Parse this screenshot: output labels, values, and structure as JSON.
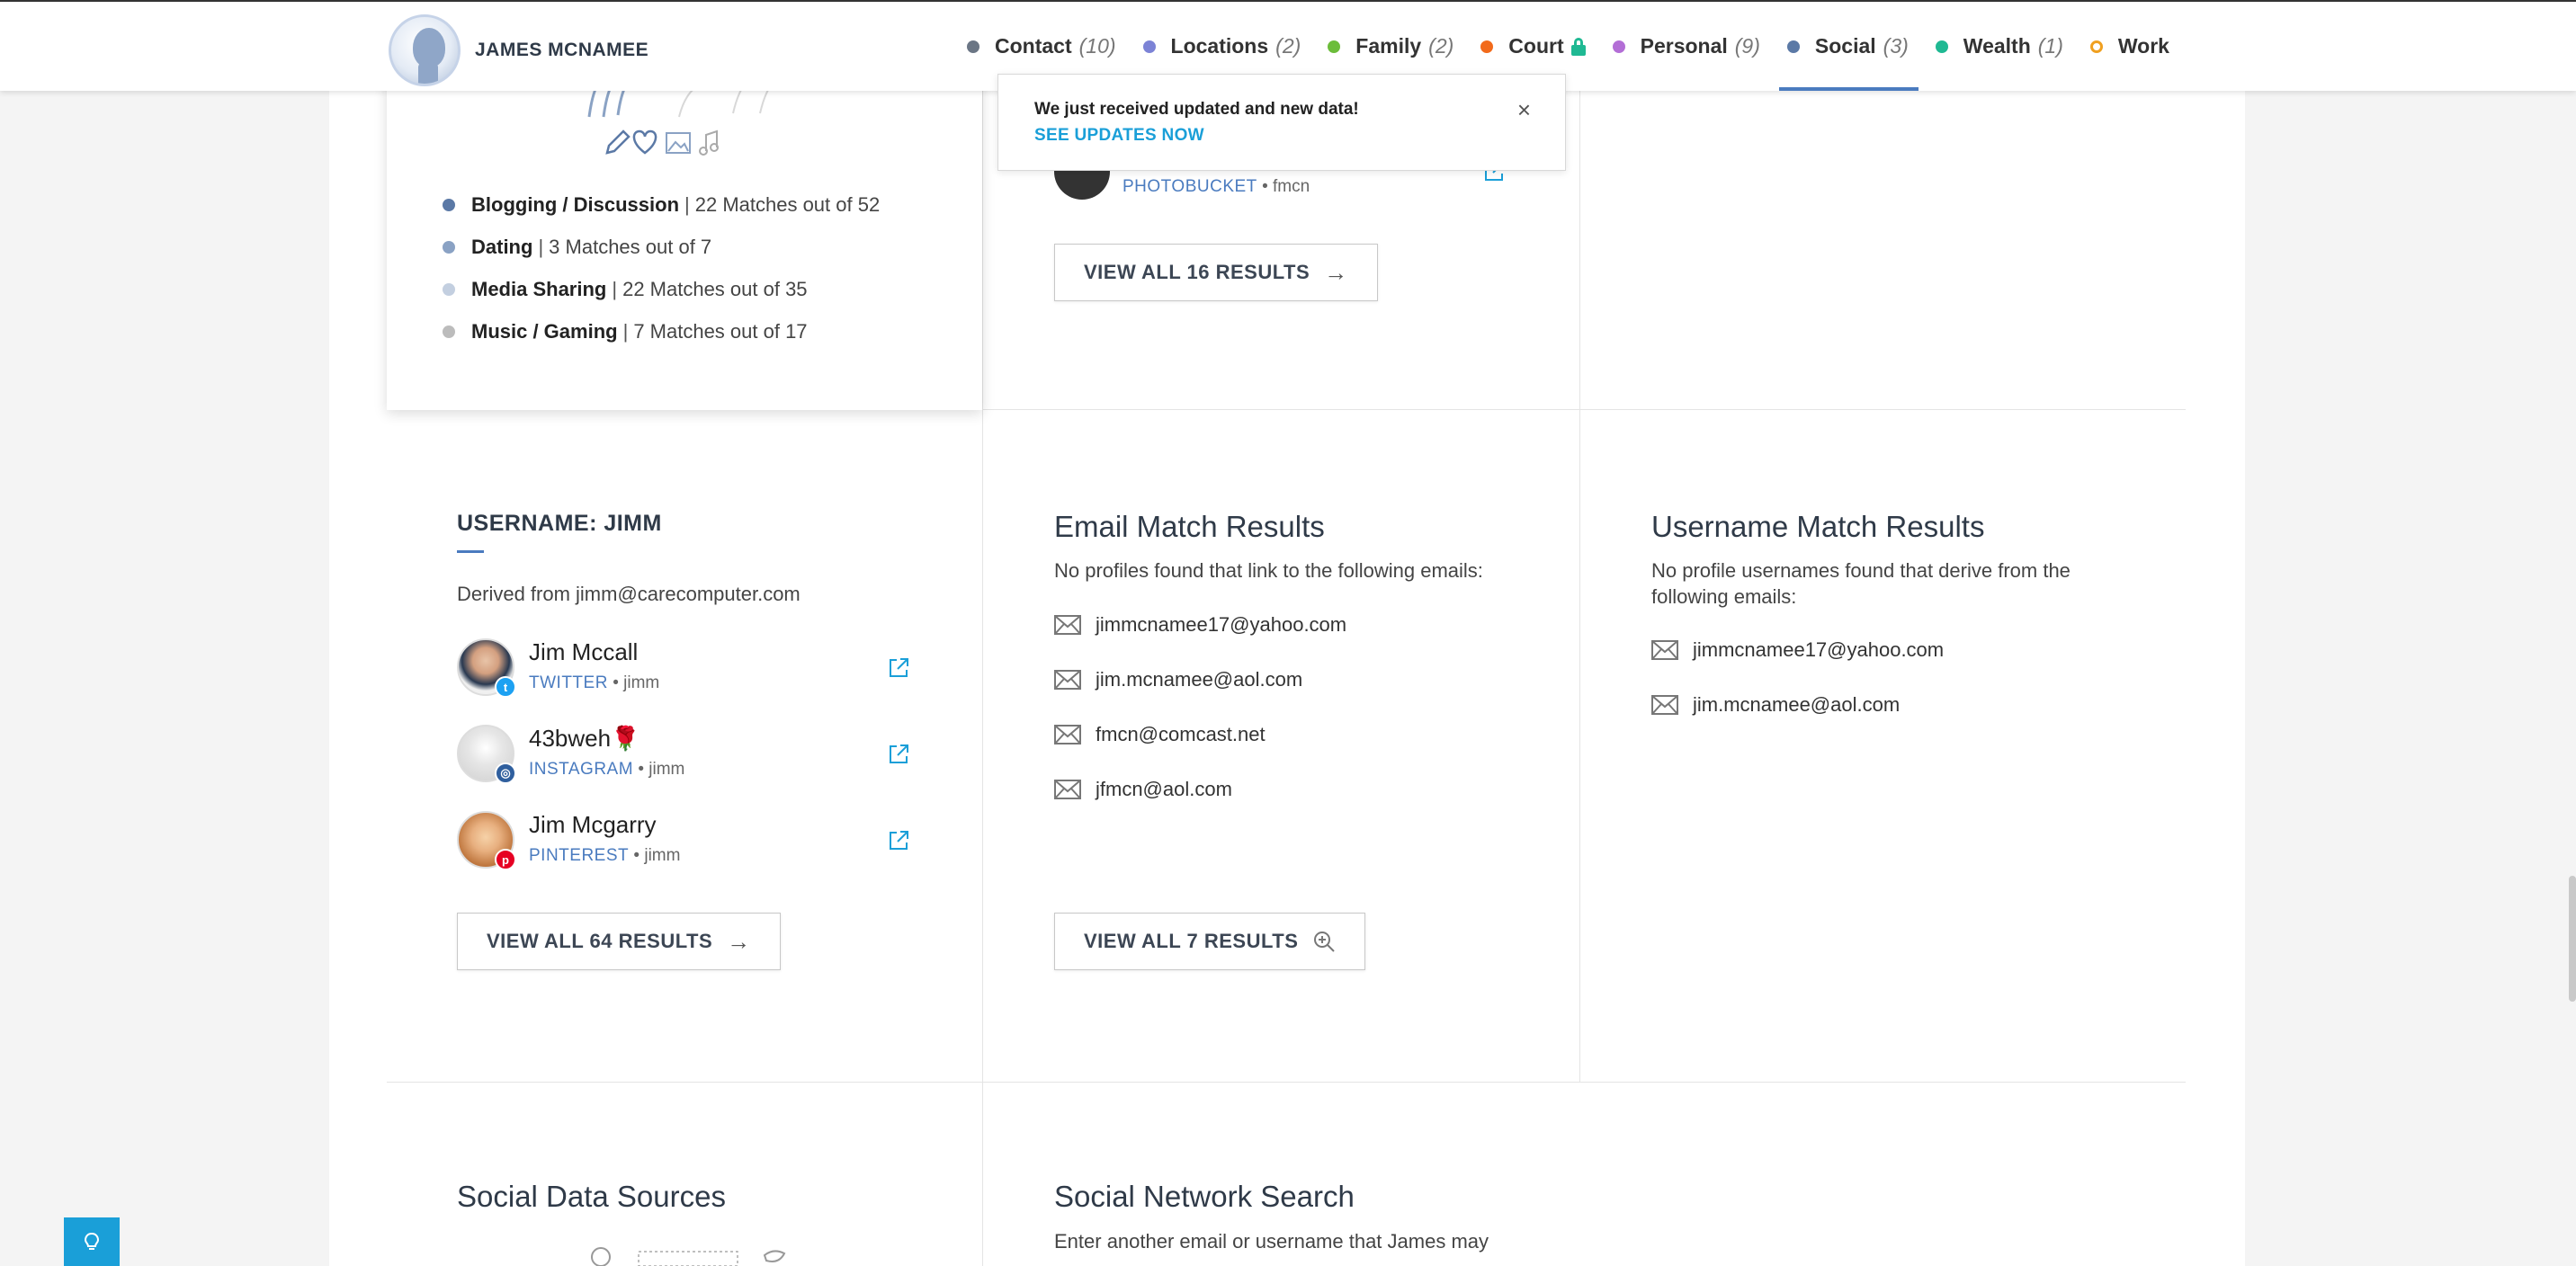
{
  "header": {
    "name": "JAMES MCNAMEE",
    "nav": [
      {
        "label": "Contact",
        "count": "(10)",
        "color": "#6b7685"
      },
      {
        "label": "Locations",
        "count": "(2)",
        "color": "#7c83d6"
      },
      {
        "label": "Family",
        "count": "(2)",
        "color": "#6cbd3a"
      },
      {
        "label": "Court",
        "count": "",
        "color": "#f26a1b",
        "locked": true
      },
      {
        "label": "Personal",
        "count": "(9)",
        "color": "#b36ed6"
      },
      {
        "label": "Social",
        "count": "(3)",
        "color": "#5b79a6",
        "active": true
      },
      {
        "label": "Wealth",
        "count": "(1)",
        "color": "#1fb993"
      },
      {
        "label": "Work",
        "count": "",
        "color": "#f0a020",
        "ring": true
      }
    ]
  },
  "toast": {
    "message": "We just received updated and new data!",
    "link": "SEE UPDATES NOW"
  },
  "categories": [
    {
      "label": "Blogging / Discussion",
      "value": "22 Matches out of 52",
      "color": "#5b79a6"
    },
    {
      "label": "Dating",
      "value": "3 Matches out of 7",
      "color": "#8aa2c4"
    },
    {
      "label": "Media Sharing",
      "value": "22 Matches out of 35",
      "color": "#c3cfe0"
    },
    {
      "label": "Music / Gaming",
      "value": "7 Matches out of 17",
      "color": "#bcbcbc"
    }
  ],
  "separator": "|",
  "top_match": {
    "network": "PHOTOBUCKET",
    "handle": "fmcn"
  },
  "buttons": {
    "view_all_16": "VIEW ALL 16 RESULTS",
    "view_all_64": "VIEW ALL 64 RESULTS",
    "view_all_7": "VIEW ALL 7 RESULTS"
  },
  "username_section": {
    "title": "USERNAME: JIMM",
    "derived": "Derived from jimm@carecomputer.com",
    "profiles": [
      {
        "name": "Jim Mccall",
        "network": "TWITTER",
        "handle": "jimm"
      },
      {
        "name": "43bweh🌹",
        "network": "INSTAGRAM",
        "handle": "jimm"
      },
      {
        "name": "Jim Mcgarry",
        "network": "PINTEREST",
        "handle": "jimm"
      }
    ]
  },
  "email_section": {
    "title": "Email Match Results",
    "desc": "No profiles found that link to the following emails:",
    "emails": [
      "jimmcnamee17@yahoo.com",
      "jim.mcnamee@aol.com",
      "fmcn@comcast.net",
      "jfmcn@aol.com"
    ]
  },
  "username_match_section": {
    "title": "Username Match Results",
    "desc": "No profile usernames found that derive from the following emails:",
    "emails": [
      "jimmcnamee17@yahoo.com",
      "jim.mcnamee@aol.com"
    ]
  },
  "bottom": {
    "sources_title": "Social Data Sources",
    "search_title": "Social Network Search",
    "search_desc": "Enter another email or username that James may"
  },
  "bullet": "•"
}
